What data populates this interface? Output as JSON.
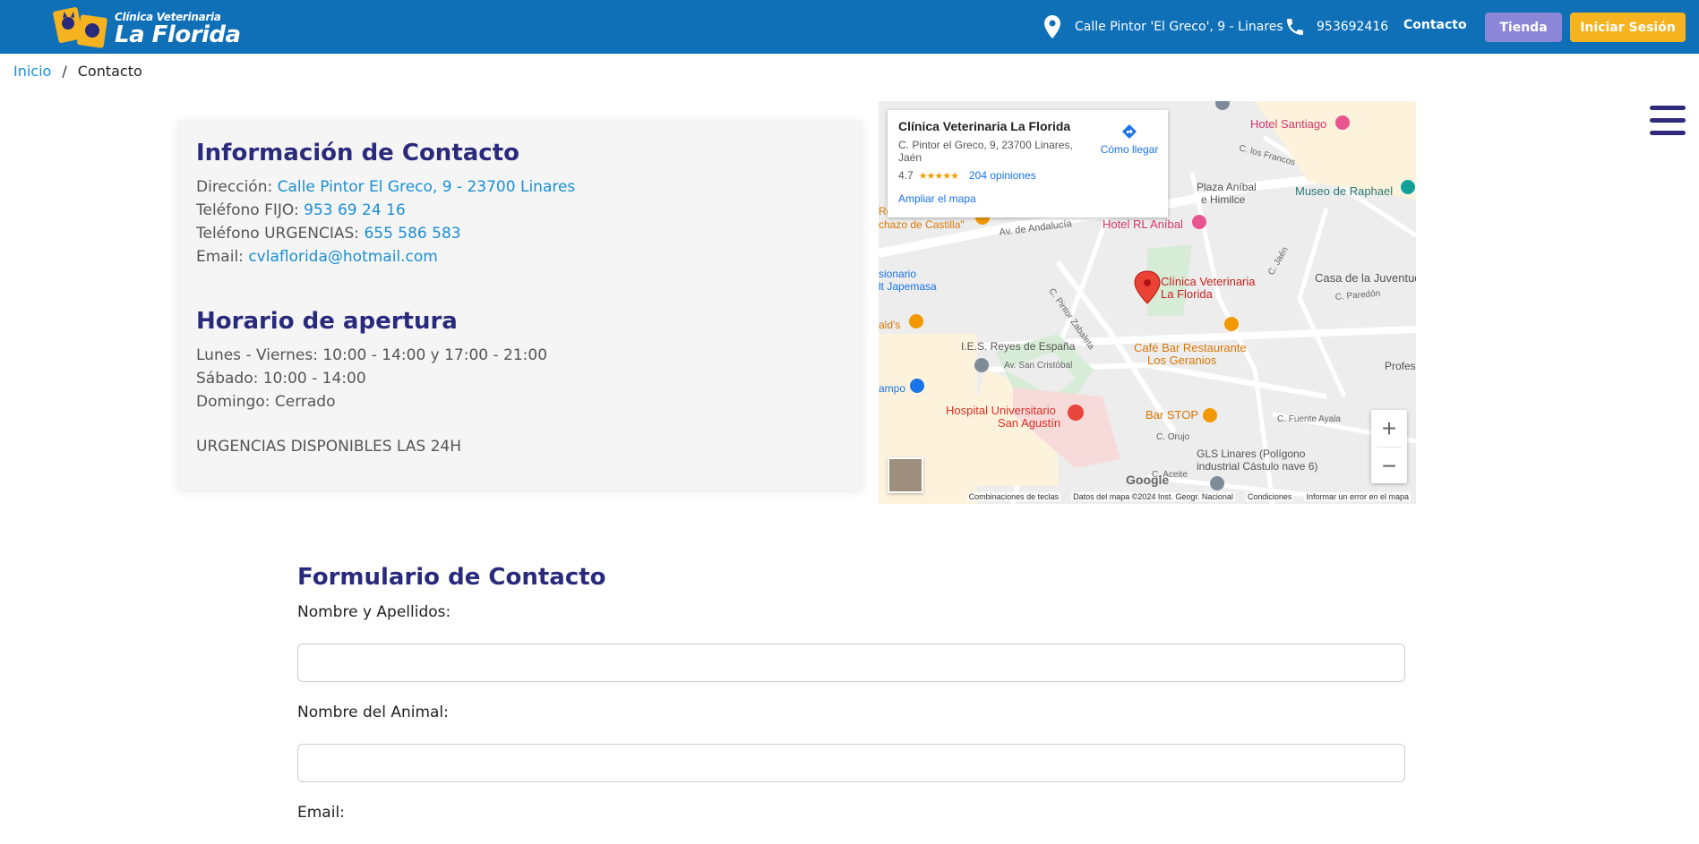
{
  "header": {
    "logo_line1": "Clínica Veterinaria",
    "logo_line2": "La Florida",
    "address": "Calle Pintor 'El Greco', 9 - Linares",
    "phone": "953692416",
    "contact_label": "Contacto",
    "shop_label": "Tienda",
    "login_label": "Iniciar Sesión",
    "brand_color": "#0f70b7",
    "shop_color": "#8b86d8",
    "login_color": "#f5b320"
  },
  "breadcrumb": {
    "home": "Inicio",
    "separator": "/",
    "current": "Contacto"
  },
  "contact_info": {
    "title": "Información de Contacto",
    "address_label": "Dirección:",
    "address_value": "Calle Pintor El Greco, 9 - 23700 Linares",
    "landline_label": "Teléfono FIJO:",
    "landline_value": "953 69 24 16",
    "emergency_label": "Teléfono URGENCIAS:",
    "emergency_value": "655 586 583",
    "email_label": "Email:",
    "email_value": "cvlaflorida@hotmail.com"
  },
  "hours": {
    "title": "Horario de apertura",
    "weekdays": "Lunes - Viernes: 10:00 - 14:00 y 17:00 - 21:00",
    "saturday": "Sábado: 10:00 - 14:00",
    "sunday": "Domingo: Cerrado",
    "emergency": "URGENCIAS DISPONIBLES LAS 24H"
  },
  "map": {
    "place_name": "Clínica Veterinaria La Florida",
    "place_address": "C. Pintor el Greco, 9, 23700 Linares, Jaén",
    "rating": "4.7",
    "stars": "★★★★★",
    "reviews": "204 opiniones",
    "directions": "Cómo llegar",
    "enlarge": "Ampliar el mapa",
    "zoom_in": "+",
    "zoom_out": "−",
    "google": "Google",
    "attrib_shortcuts": "Combinaciones de teclas",
    "attrib_data": "Datos del mapa ©2024 Inst. Geogr. Nacional",
    "attrib_terms": "Condiciones",
    "attrib_report": "Informar un error en el mapa",
    "labels": {
      "hotel_santiago": "Hotel Santiago",
      "c_francos": "C. los Francos",
      "plaza": "Plaza Aníbal",
      "himilce": "e Himilce",
      "museo": "Museo de Raphael",
      "hotel_rl": "Hotel RL Aníbal",
      "restaurante": "Restaurante \"El",
      "chazo": "chazo de Castilla\"",
      "av_andalucia": "Av. de Andalucía",
      "sionario": "sionario",
      "japemasa": "lt Japemasa",
      "pintor_zab": "C. Pintor Zabaleta",
      "pin1": "Clínica Veterinaria",
      "pin2": "La Florida",
      "jaen": "C. Jaén",
      "casa_juventud": "Casa de la Juventud",
      "paredon": "C. Paredón",
      "alds": "ald's",
      "ies": "I.E.S. Reyes de España",
      "av_cristobal": "Av. San Cristóbal",
      "cafe1": "Café Bar Restaurante",
      "cafe2": "Los Geranios",
      "profesional": "Profesiona",
      "ampo": "ampo",
      "hospital1": "Hospital Universitario",
      "hospital2": "San Agustín",
      "bar_stop": "Bar STOP",
      "fuente": "C. Fuente Ayala",
      "orujo": "C. Orujo",
      "gls1": "GLS Linares (Polígono",
      "gls2": "industrial Cástulo nave 6)",
      "aceite": "C. Aceite"
    }
  },
  "form": {
    "title": "Formulario de Contacto",
    "name_label": "Nombre y Apellidos:",
    "animal_label": "Nombre del Animal:",
    "email_label": "Email:"
  }
}
